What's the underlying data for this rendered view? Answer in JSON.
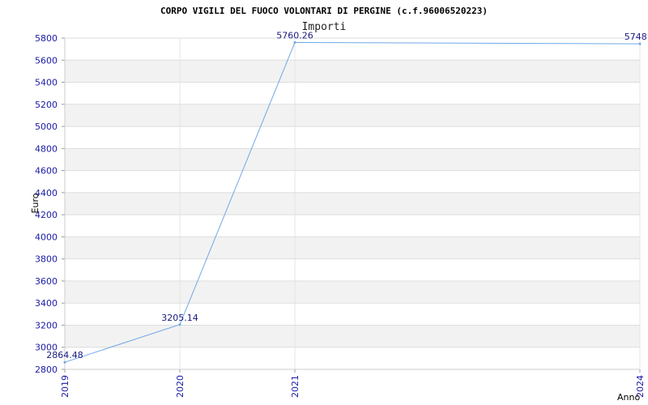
{
  "chart_data": {
    "type": "line",
    "title": "CORPO VIGILI DEL FUOCO VOLONTARI DI PERGINE (c.f.96006520223)",
    "subtitle": "Importi",
    "xlabel": "Anno",
    "ylabel": "Euro",
    "categories": [
      "2019",
      "2020",
      "2021",
      "2024"
    ],
    "series": [
      {
        "values": [
          2864.48,
          3205.14,
          5760.26,
          5748.0
        ],
        "labels": [
          "2864.48",
          "3205.14",
          "5760.26",
          "5748.0"
        ]
      }
    ],
    "ylim": [
      2800,
      5800
    ],
    "ytick_step": 200,
    "grid": true,
    "line_color": "#6fa8e6",
    "band_color": "#f2f2f2",
    "tick_color": "#1a1aa6"
  }
}
